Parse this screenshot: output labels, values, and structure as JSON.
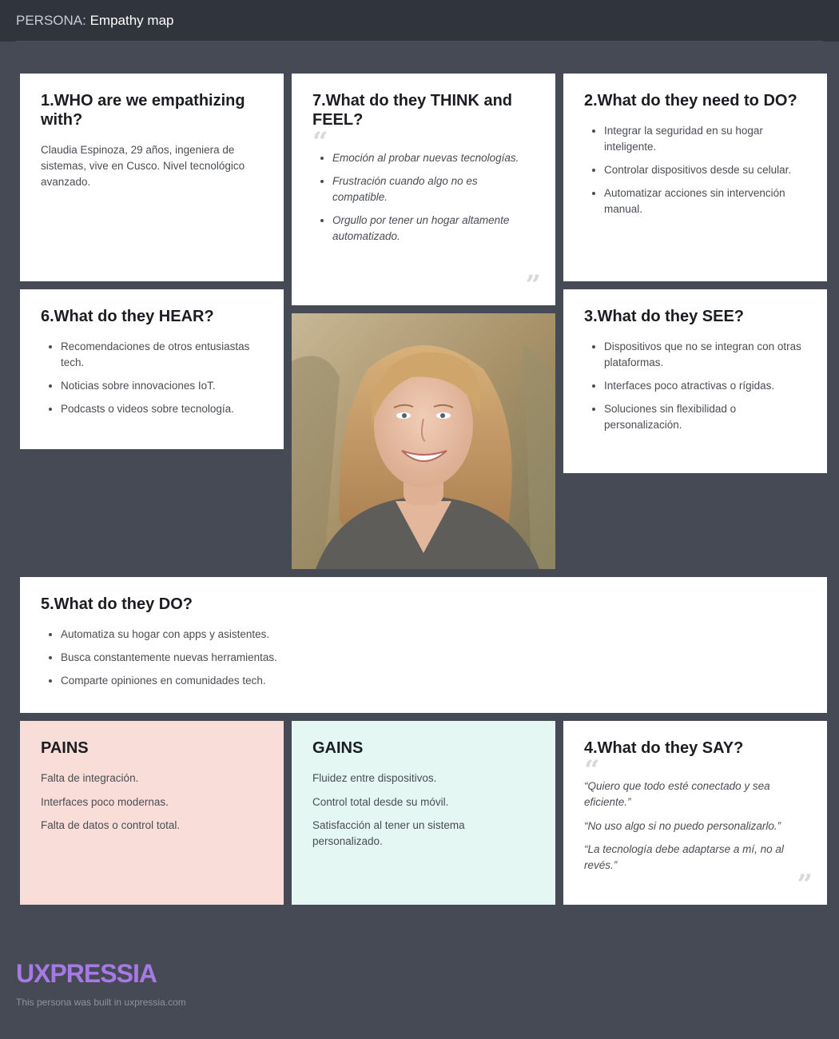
{
  "header": {
    "prefix": "PERSONA:",
    "title": "Empathy map"
  },
  "who": {
    "heading": "1.WHO are we empathizing with?",
    "text": "Claudia Espinoza, 29 años, ingeniera de sistemas, vive en Cusco. Nivel tecnológico avanzado."
  },
  "think_feel": {
    "heading": "7.What do they THINK and FEEL?",
    "items": [
      "Emoción al probar nuevas tecnologías.",
      "Frustración cuando algo no es compatible.",
      "Orgullo por tener un hogar altamente automatizado."
    ]
  },
  "need_do": {
    "heading": "2.What do they need to DO?",
    "items": [
      "Integrar la seguridad en su hogar inteligente.",
      "Controlar dispositivos desde su celular.",
      "Automatizar acciones sin intervención manual."
    ]
  },
  "hear": {
    "heading": "6.What do they HEAR?",
    "items": [
      "Recomendaciones de otros entusiastas tech.",
      "Noticias sobre innovaciones IoT.",
      "Podcasts o videos sobre tecnología."
    ]
  },
  "see": {
    "heading": "3.What do they SEE?",
    "items": [
      "Dispositivos que no se integran con otras plataformas.",
      "Interfaces poco atractivas o rígidas.",
      "Soluciones sin flexibilidad o personalización."
    ]
  },
  "do": {
    "heading": "5.What do they DO?",
    "items": [
      "Automatiza su hogar con apps y asistentes.",
      "Busca constantemente nuevas herramientas.",
      "Comparte opiniones en comunidades tech."
    ]
  },
  "pains": {
    "heading": "PAINS",
    "items": [
      "Falta de integración.",
      "Interfaces poco modernas.",
      "Falta de datos o control total."
    ]
  },
  "gains": {
    "heading": "GAINS",
    "items": [
      "Fluidez entre dispositivos.",
      "Control total desde su móvil.",
      "Satisfacción al tener un sistema personalizado."
    ]
  },
  "say": {
    "heading": "4.What do they SAY?",
    "items": [
      "“Quiero que todo esté conectado y sea eficiente.”",
      "“No uso algo si no puedo personalizarlo.”",
      "“La tecnología debe adaptarse a mí, no al revés.”"
    ]
  },
  "quote_marks": {
    "open": "“",
    "close": "”"
  },
  "brand": {
    "logo": "UXPRESSIA",
    "footer": "This persona was built in uxpressia.com"
  },
  "colors": {
    "background": "#454a55",
    "header": "#30343c",
    "pains": "#f9ddd9",
    "gains": "#e4f7f3",
    "logo": "#a679e4"
  }
}
